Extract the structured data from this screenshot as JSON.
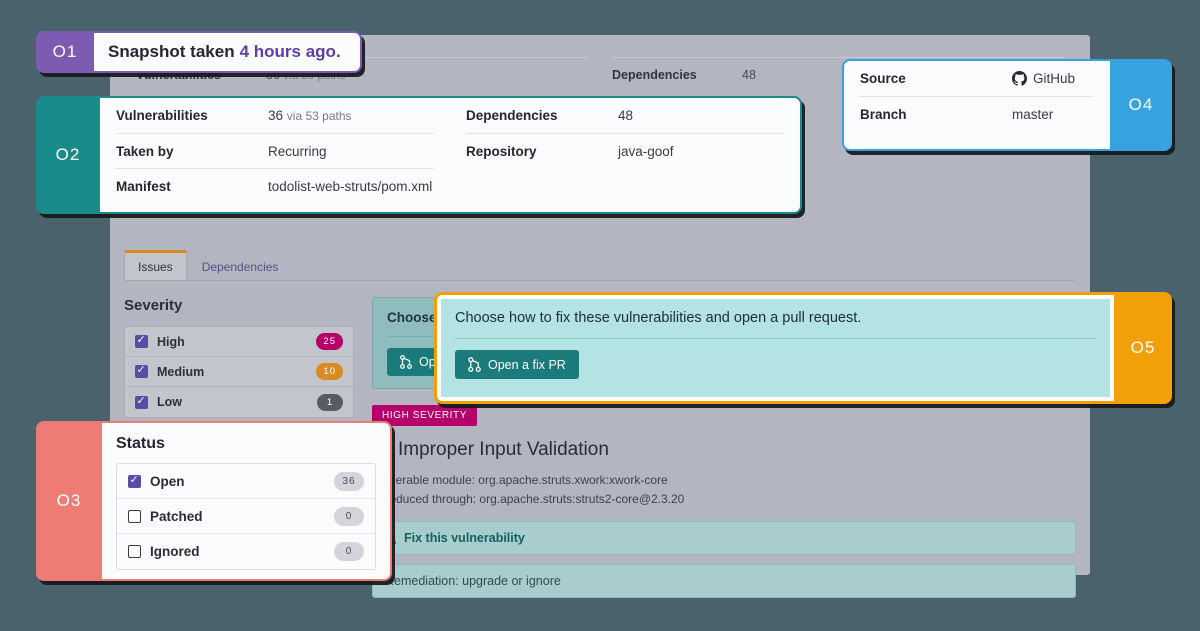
{
  "callouts": {
    "one": {
      "num": "O1",
      "color": "#7d5bb3"
    },
    "two": {
      "num": "O2",
      "color": "#1a8b8b"
    },
    "three": {
      "num": "O3",
      "color": "#ee7b74"
    },
    "four": {
      "num": "O4",
      "color": "#36a2e0"
    },
    "five": {
      "num": "O5",
      "color": "#f2a007"
    }
  },
  "snapshot": {
    "prefix": "Snapshot taken",
    "highlight": "4 hours ago."
  },
  "project_details": {
    "left": [
      {
        "key": "Vulnerabilities",
        "value": "36",
        "suffix": "via 53 paths"
      },
      {
        "key": "Taken by",
        "value": "Recurring",
        "suffix": ""
      },
      {
        "key": "Manifest",
        "value": "todolist-web-struts/pom.xml",
        "suffix": "",
        "link": true
      }
    ],
    "right": [
      {
        "key": "Dependencies",
        "value": "48",
        "suffix": ""
      },
      {
        "key": "Repository",
        "value": "java-goof",
        "suffix": "",
        "link": true
      }
    ]
  },
  "source_info": {
    "rows": [
      {
        "key": "Source",
        "value": "GitHub",
        "icon": "github-icon"
      },
      {
        "key": "Branch",
        "value": "master",
        "icon": ""
      }
    ]
  },
  "fix_pr": {
    "title": "Choose how to fix these vulnerabilities and open a pull request.",
    "button_label": "Open a fix PR",
    "button_icon": "pull-request-icon"
  },
  "status_filter": {
    "title": "Status",
    "items": [
      {
        "label": "Open",
        "count": "36",
        "checked": true
      },
      {
        "label": "Patched",
        "count": "0",
        "checked": false
      },
      {
        "label": "Ignored",
        "count": "0",
        "checked": false
      }
    ]
  },
  "background": {
    "summary_strip": {
      "left": [
        {
          "key": "Vulnerabilities",
          "value": "36",
          "suffix": "via 53 paths"
        }
      ],
      "right": [
        {
          "key": "Dependencies",
          "value": "48",
          "suffix": ""
        }
      ]
    },
    "tabs": [
      {
        "label": "Issues",
        "active": true
      },
      {
        "label": "Dependencies",
        "active": false
      }
    ],
    "severity_filter": {
      "title": "Severity",
      "items": [
        {
          "label": "High",
          "count": "25",
          "color": "#b5006b",
          "checked": true
        },
        {
          "label": "Medium",
          "count": "10",
          "color": "#d98a22",
          "checked": true
        },
        {
          "label": "Low",
          "count": "1",
          "color": "#5a5a64",
          "checked": true
        }
      ]
    },
    "choose_card": {
      "title": "Choose how to fix these vulnerabilities and open a pull request.",
      "button_label": "Open a fix PR"
    },
    "vulnerability": {
      "severity_tag": "HIGH SEVERITY",
      "title": "Improper Input Validation",
      "title_icon": "shield-icon",
      "module_line": "Vulnerable module: org.apache.struts.xwork:xwork-core",
      "introduced_line": "Introduced through: org.apache.struts:struts2-core@2.3.20",
      "fix_link": "Fix this vulnerability",
      "fix_link_icon": "pull-request-icon",
      "detail_line": "Remediation: upgrade or ignore"
    }
  }
}
